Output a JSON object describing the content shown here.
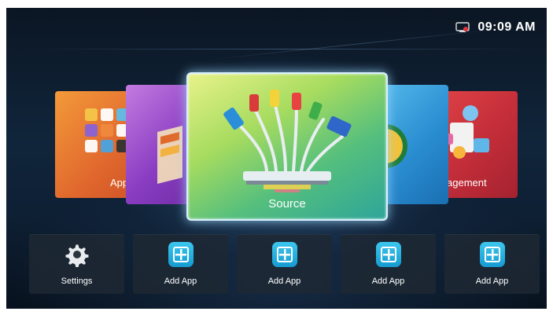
{
  "status": {
    "time": "09:09 AM",
    "network_icon": "ethernet-disconnected-icon"
  },
  "cards": {
    "apps": {
      "label": "App",
      "icon": "apps-grid-icon"
    },
    "media": {
      "icon": "media-film-icon"
    },
    "source": {
      "label": "Source",
      "icon": "cables-source-icon"
    },
    "browser": {
      "icon": "browser-globe-icon"
    },
    "management": {
      "label": "agement",
      "icon": "app-management-icon"
    }
  },
  "shortcuts": [
    {
      "label": "Settings",
      "icon": "gear-icon"
    },
    {
      "label": "Add App",
      "icon": "add-app-icon"
    },
    {
      "label": "Add App",
      "icon": "add-app-icon"
    },
    {
      "label": "Add App",
      "icon": "add-app-icon"
    },
    {
      "label": "Add App",
      "icon": "add-app-icon"
    }
  ],
  "colors": {
    "apps_card": "#e0672d",
    "media_card": "#8a3dc2",
    "source_card": "#6cc46a",
    "browser_card": "#2b8fd2",
    "management_card": "#c62f3a",
    "add_icon": "#22aee0"
  }
}
